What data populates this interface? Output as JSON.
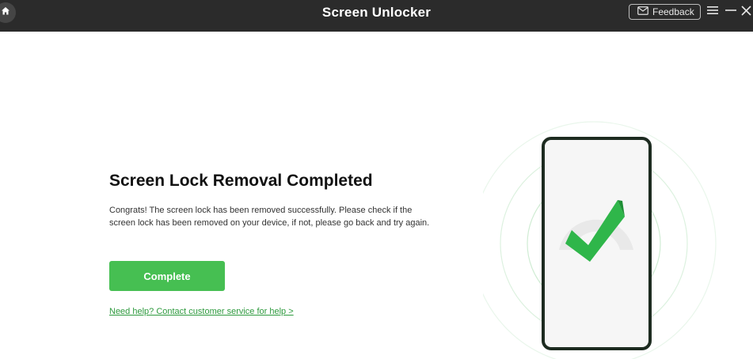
{
  "app": {
    "title": "Screen Unlocker",
    "feedback_label": "Feedback"
  },
  "icons": {
    "home": "home-icon",
    "mail": "mail-icon",
    "menu": "menu-icon",
    "minimize": "minimize-icon",
    "close": "close-icon",
    "phone": "phone-icon",
    "check": "checkmark-icon"
  },
  "main": {
    "heading": "Screen Lock Removal Completed",
    "description": "Congrats! The screen lock has been removed successfully. Please check if the screen lock has been removed on your device, if not, please go back and try again.",
    "complete_label": "Complete",
    "help_link": "Need help? Contact customer service for help >"
  },
  "colors": {
    "titlebar": "#2b2b2b",
    "accent": "#46bf52",
    "link": "#2e9a3e"
  }
}
